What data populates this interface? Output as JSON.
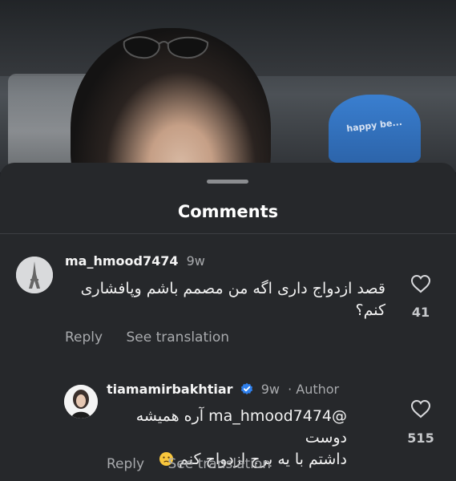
{
  "sheet": {
    "title": "Comments"
  },
  "video": {
    "hat_text": "happy be..."
  },
  "comments": [
    {
      "username": "ma_hmood7474",
      "time": "9w",
      "text_line1": "قصد ازدواج داری اگه من مصمم باشم وپافشاری",
      "text_line2": "کنم؟",
      "likes": "41",
      "reply_label": "Reply",
      "translate_label": "See translation"
    },
    {
      "username": "tiamamirbakhtiar",
      "time": "9w",
      "author_label": "· Author",
      "text_line1": "@ma_hmood7474 آره همیشه دوست",
      "text_line2": "داشتم با یه برج ازدواج کنم",
      "likes": "515",
      "reply_label": "Reply",
      "translate_label": "See translation"
    }
  ],
  "colors": {
    "sheet_bg": "#26282b",
    "primary_text": "#f5f5f5",
    "secondary_text": "#a8aaad",
    "verified_blue": "#2f80ed"
  },
  "icons": {
    "like": "heart-outline-icon",
    "verified": "verified-badge-icon",
    "emoji": "crying-face-icon"
  }
}
